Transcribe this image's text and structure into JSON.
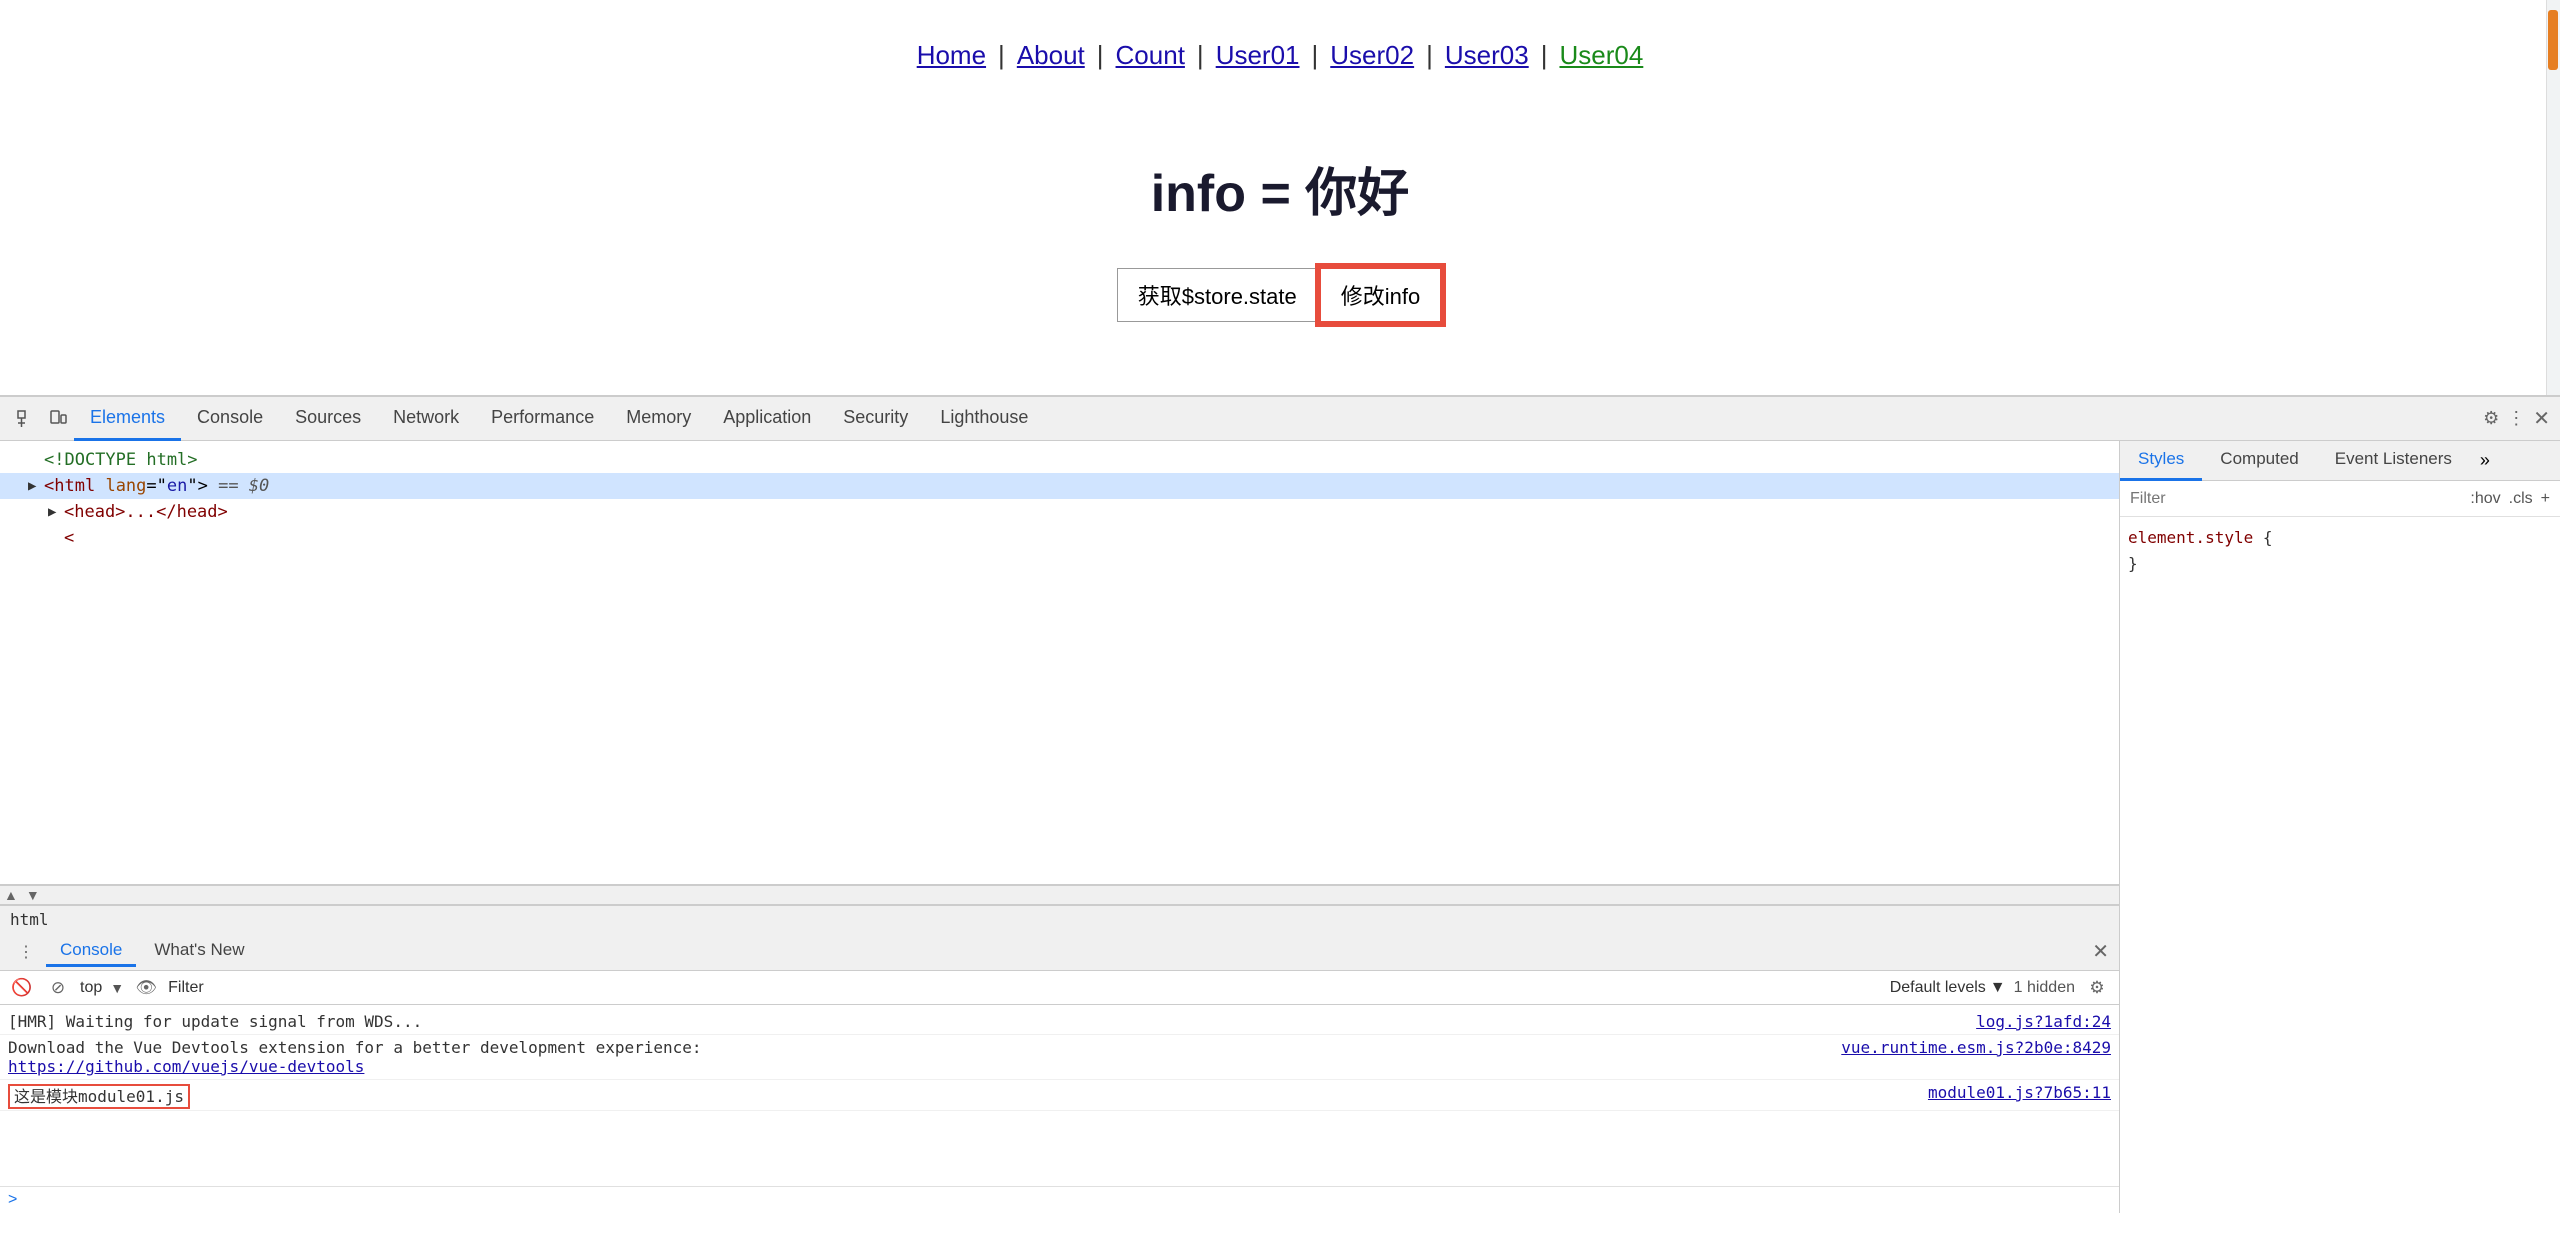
{
  "browser": {
    "scrollbar_color": "#e67e22"
  },
  "page": {
    "nav": {
      "links": [
        {
          "label": "Home",
          "active": false
        },
        {
          "label": "About",
          "active": false
        },
        {
          "label": "Count",
          "active": false
        },
        {
          "label": "User01",
          "active": false
        },
        {
          "label": "User02",
          "active": false
        },
        {
          "label": "User03",
          "active": false
        },
        {
          "label": "User04",
          "active": true
        }
      ]
    },
    "heading": "info = 你好",
    "btn_get_label": "获取$store.state",
    "btn_modify_label": "修改info"
  },
  "devtools": {
    "tabs": [
      {
        "label": "Elements",
        "active": true
      },
      {
        "label": "Console",
        "active": false
      },
      {
        "label": "Sources",
        "active": false
      },
      {
        "label": "Network",
        "active": false
      },
      {
        "label": "Performance",
        "active": false
      },
      {
        "label": "Memory",
        "active": false
      },
      {
        "label": "Application",
        "active": false
      },
      {
        "label": "Security",
        "active": false
      },
      {
        "label": "Lighthouse",
        "active": false
      }
    ],
    "elements": {
      "rows": [
        {
          "text": "<!DOCTYPE html>",
          "indent": 0,
          "type": "comment"
        },
        {
          "text": "<html lang=\"en\"> == $0",
          "indent": 0,
          "type": "tag",
          "arrow": "▶"
        },
        {
          "text": "<head>...</head>",
          "indent": 1,
          "type": "tag",
          "arrow": "▶"
        },
        {
          "text": "<",
          "indent": 1,
          "type": "tag"
        }
      ],
      "breadcrumb": "html"
    },
    "right_panel": {
      "tabs": [
        {
          "label": "Styles",
          "active": true
        },
        {
          "label": "Computed",
          "active": false
        },
        {
          "label": "Event Listeners",
          "active": false
        }
      ],
      "filter_placeholder": "Filter",
      "filter_buttons": [
        ":hov",
        ".cls",
        "+"
      ],
      "style_rules": [
        {
          "selector": "element.style",
          "open_brace": " {",
          "properties": [],
          "close_brace": "}"
        }
      ]
    },
    "console": {
      "tabs": [
        {
          "label": "Console",
          "active": true
        },
        {
          "label": "What's New",
          "active": false
        }
      ],
      "top_selector": "top",
      "filter_placeholder": "Filter",
      "levels": "Default levels",
      "hidden_count": "1 hidden",
      "messages": [
        {
          "text": "[HMR] Waiting for update signal from WDS...",
          "link": "log.js?1afd:24",
          "highlight": false
        },
        {
          "text": "Download the Vue Devtools extension for a better development experience:\nhttps://github.com/vuejs/vue-devtools",
          "link": "vue.runtime.esm.js?2b0e:8429",
          "highlight": false
        },
        {
          "text": "这是模块module01.js",
          "link": "module01.js?7b65:11",
          "highlight": true
        }
      ]
    }
  }
}
